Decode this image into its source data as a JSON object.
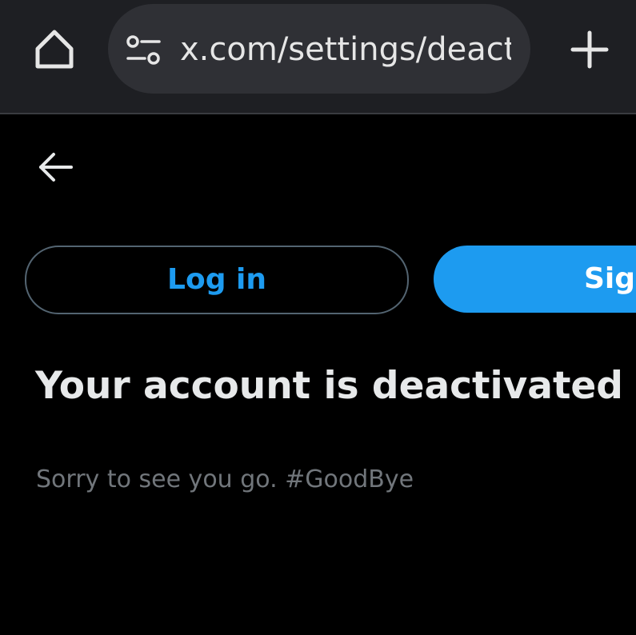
{
  "browser": {
    "url": "x.com/settings/deact",
    "home_icon": "home-icon",
    "site_settings_icon": "tune-icon",
    "new_tab_icon": "plus-icon"
  },
  "page": {
    "back_icon": "arrow-left-icon",
    "login_label": "Log in",
    "signup_label": "Sign",
    "headline": "Your account is deactivated",
    "subtext": "Sorry to see you go. #GoodBye"
  },
  "colors": {
    "accent": "#1d9bf0",
    "background": "#000000",
    "toolbar": "#1e1f23",
    "urlbar": "#2f3035",
    "primary_text": "#e7e9ea",
    "secondary_text": "#71767b",
    "button_border": "#536471"
  }
}
